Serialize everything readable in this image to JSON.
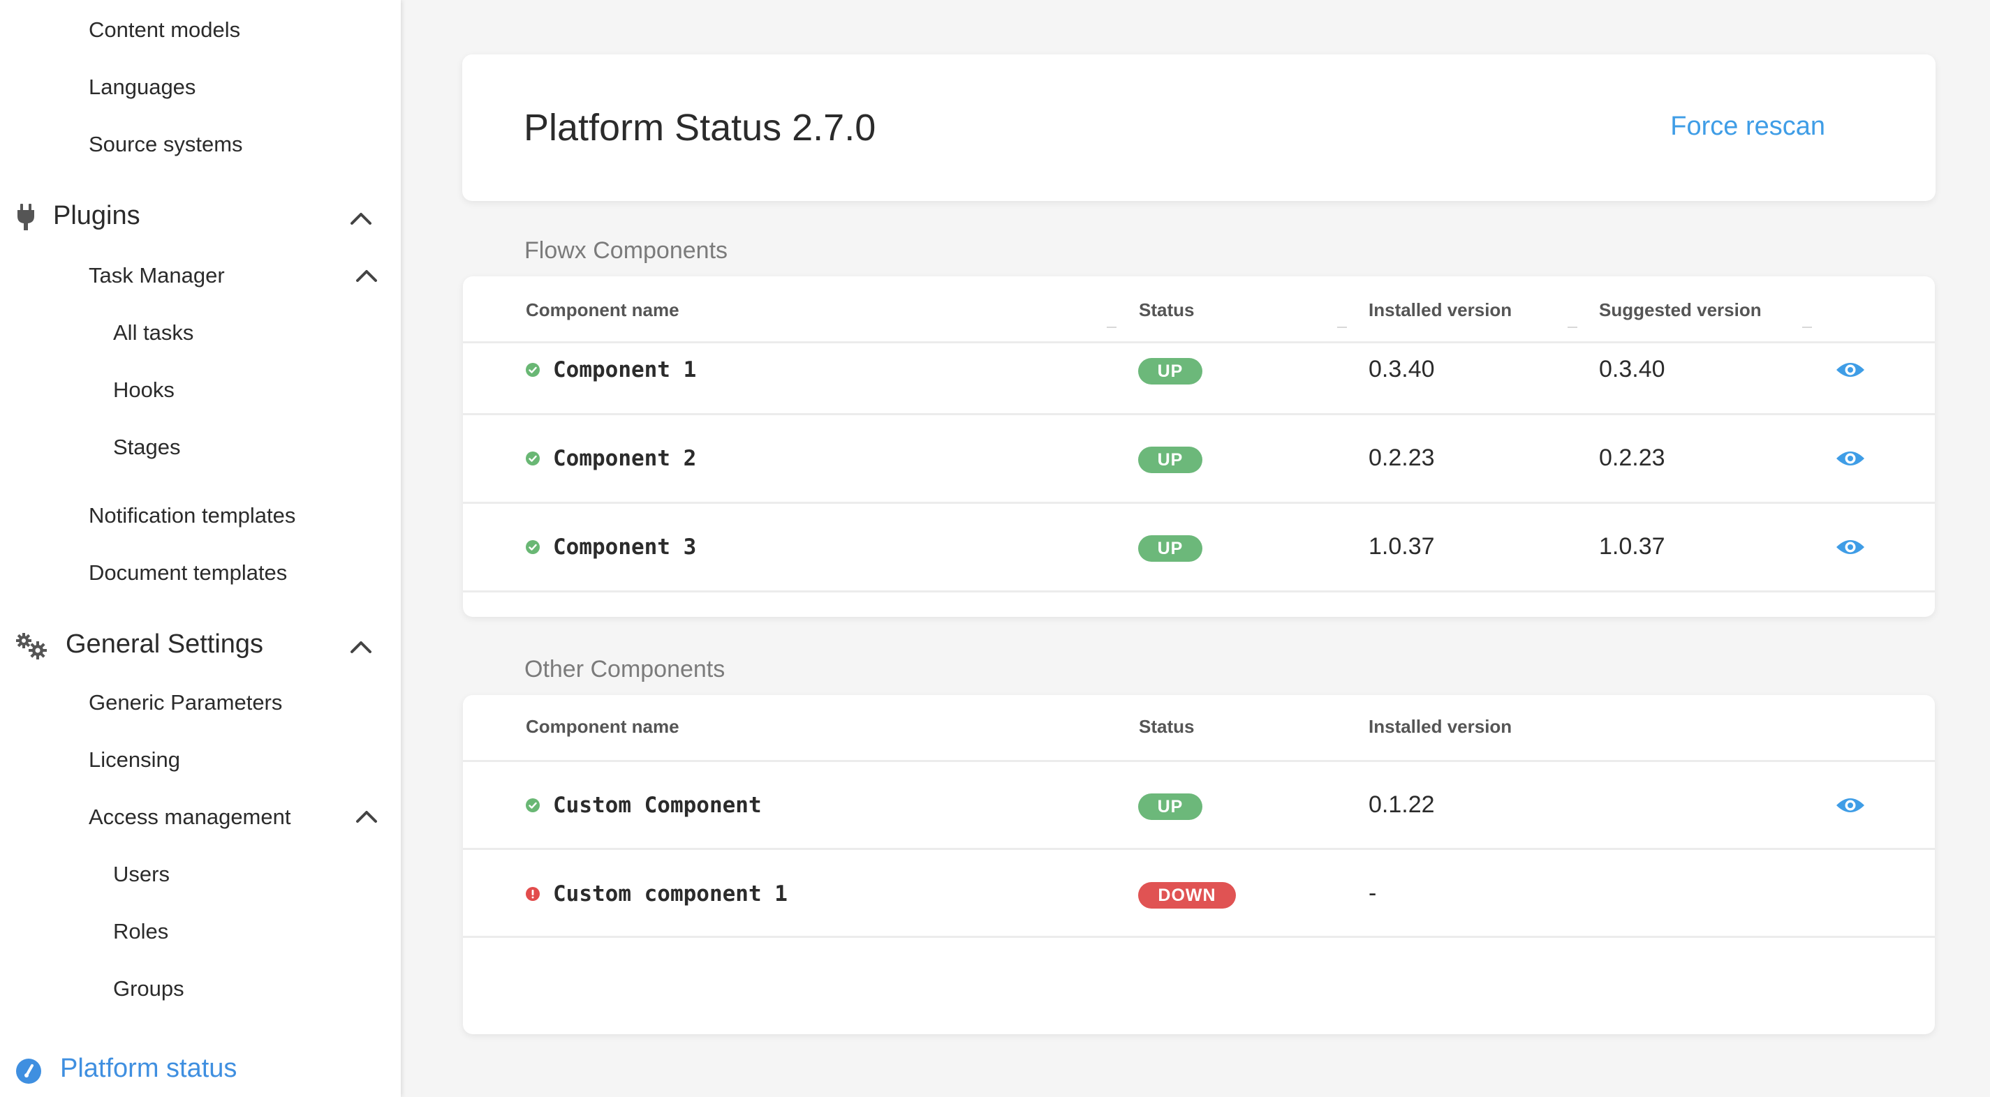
{
  "sidebar": {
    "items": {
      "content_models": "Content models",
      "languages": "Languages",
      "source_systems": "Source systems",
      "task_manager": "Task Manager",
      "all_tasks": "All tasks",
      "hooks": "Hooks",
      "stages": "Stages",
      "notification_templates": "Notification templates",
      "document_templates": "Document templates",
      "generic_parameters": "Generic Parameters",
      "licensing": "Licensing",
      "access_management": "Access management",
      "users": "Users",
      "roles": "Roles",
      "groups": "Groups"
    },
    "groups": {
      "plugins": "Plugins",
      "general_settings": "General Settings"
    },
    "active": "Platform status",
    "active_color": "#3f8fe0",
    "icons": {
      "plugins": "plug-icon",
      "general_settings": "gears-icon",
      "platform_status": "gauge-icon",
      "collapse": "chevron-up-icon"
    }
  },
  "header": {
    "title": "Platform Status 2.7.0",
    "force_rescan": "Force rescan"
  },
  "flowx": {
    "title": "Flowx Components",
    "columns": [
      "Component name",
      "Status",
      "Installed version",
      "Suggested version"
    ],
    "rows": [
      {
        "name": "Component 1",
        "status": "UP",
        "installed": "0.3.40",
        "suggested": "0.3.40"
      },
      {
        "name": "Component 2",
        "status": "UP",
        "installed": "0.2.23",
        "suggested": "0.2.23"
      },
      {
        "name": "Component 3",
        "status": "UP",
        "installed": "1.0.37",
        "suggested": "1.0.37"
      }
    ]
  },
  "other": {
    "title": "Other Components",
    "columns": [
      "Component name",
      "Status",
      "Installed version"
    ],
    "rows": [
      {
        "name": "Custom Component",
        "status": "UP",
        "installed": "0.1.22"
      },
      {
        "name": "Custom component 1",
        "status": "DOWN",
        "installed": "-"
      }
    ]
  },
  "colors": {
    "up": "#6cb87a",
    "down": "#e05353",
    "link": "#3f9de6"
  }
}
